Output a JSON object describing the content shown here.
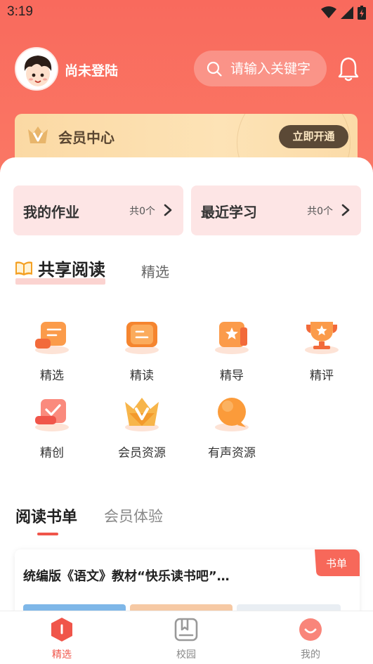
{
  "status_bar": {
    "time": "3:19"
  },
  "profile": {
    "username": "尚未登陆"
  },
  "search": {
    "placeholder": "请输入关键字"
  },
  "member": {
    "title": "会员中心",
    "button": "立即开通"
  },
  "quick_cards": [
    {
      "title": "我的作业",
      "count": "共0个"
    },
    {
      "title": "最近学习",
      "count": "共0个"
    }
  ],
  "shared_reading": {
    "title": "共享阅读",
    "tab": "精选",
    "items": [
      {
        "label": "精选",
        "icon": "scroll-icon"
      },
      {
        "label": "精读",
        "icon": "open-book-icon"
      },
      {
        "label": "精导",
        "icon": "star-book-icon"
      },
      {
        "label": "精评",
        "icon": "trophy-icon"
      },
      {
        "label": "精创",
        "icon": "check-card-icon"
      },
      {
        "label": "会员资源",
        "icon": "vip-crown-icon"
      },
      {
        "label": "有声资源",
        "icon": "speech-bubble-icon"
      }
    ]
  },
  "reading_tabs": {
    "active": "阅读书单",
    "inactive": "会员体验"
  },
  "book_list": {
    "title": "统编版《语文》教材“快乐读书吧”…",
    "tag": "书单"
  },
  "bottom_nav": [
    {
      "label": "精选",
      "active": true
    },
    {
      "label": "校园",
      "active": false
    },
    {
      "label": "我的",
      "active": false
    }
  ],
  "colors": {
    "brand": "#f96a5d",
    "accent": "#f0554a",
    "member_dark": "#5b4936",
    "member_gold": "#fbd9a4"
  }
}
